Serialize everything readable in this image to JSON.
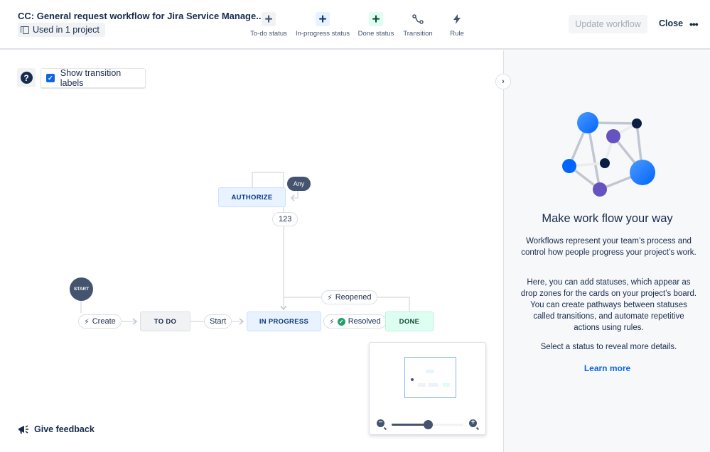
{
  "header": {
    "title": "CC: General request workflow for Jira Service Manage...",
    "used_in": "Used in 1 project",
    "toolbar": [
      {
        "label": "To-do status",
        "icon": "plus-icon",
        "color": "#f1f2f4",
        "fg": "#44546f"
      },
      {
        "label": "In-progress status",
        "icon": "plus-icon",
        "color": "#e9f2ff",
        "fg": "#0c3a7a"
      },
      {
        "label": "Done status",
        "icon": "plus-icon",
        "color": "#dcfff1",
        "fg": "#164b35"
      },
      {
        "label": "Transition",
        "icon": "transition-icon"
      },
      {
        "label": "Rule",
        "icon": "bolt-icon"
      }
    ],
    "update_label": "Update workflow",
    "close_label": "Close",
    "more_label": "•••"
  },
  "canvas": {
    "show_labels": "Show transition labels",
    "show_labels_checked": true,
    "help": "?",
    "start": "START",
    "any": "Any",
    "statuses": {
      "authorize": "AUTHORIZE",
      "todo": "TO DO",
      "in_progress": "IN PROGRESS",
      "done": "DONE"
    },
    "transitions": {
      "create": "Create",
      "start": "Start",
      "t123": "123",
      "reopened": "Reopened",
      "resolved": "Resolved"
    },
    "feedback": "Give feedback",
    "zoom_level": 0.5
  },
  "sidebar": {
    "title": "Make work flow your way",
    "p1": "Workflows represent your team’s process and control how people progress your project’s work.",
    "p2": "Here, you can add statuses, which appear as drop zones for the cards on your project’s board. You can create pathways between statuses called transitions, and automate repetitive actions using rules.",
    "p3": "Select a status to reveal more details.",
    "learn_more": "Learn more",
    "collapse": "›"
  }
}
